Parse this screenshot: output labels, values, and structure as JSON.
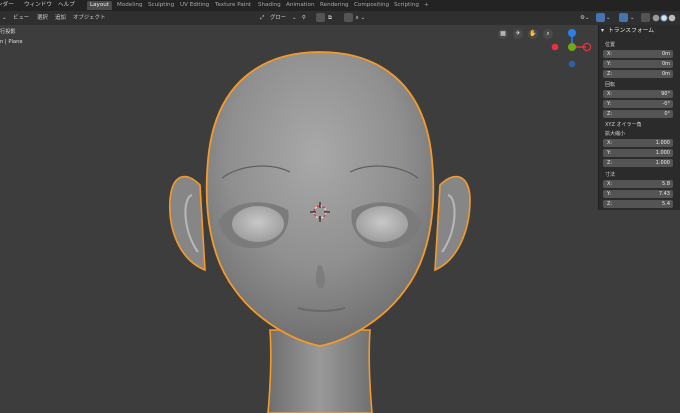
{
  "top_menu": {
    "render": "ンダー",
    "window": "ウィンドウ",
    "help": "ヘルプ"
  },
  "workspace_tabs": [
    "Layout",
    "Modeling",
    "Sculpting",
    "UV Editing",
    "Texture Paint",
    "Shading",
    "Animation",
    "Rendering",
    "Compositing",
    "Scripting"
  ],
  "add_tab": "+",
  "header": {
    "view": "ビュー",
    "select": "選択",
    "add": "追加",
    "object": "オブジェクト",
    "global": "グロー"
  },
  "viewport_info": {
    "line1": "行投影",
    "line2": "n | Plane"
  },
  "transform_panel": {
    "title": "トランスフォーム",
    "location": {
      "label": "位置",
      "x": "0m",
      "y": "0m",
      "z": "0m"
    },
    "rotation": {
      "label": "回転",
      "x": "90°",
      "y": "-0°",
      "z": "0°"
    },
    "rotation_mode": "XYZ オイラー角",
    "scale": {
      "label": "拡大縮小",
      "x": "1.000",
      "y": "1.000",
      "z": "1.000"
    },
    "dimensions": {
      "label": "寸法",
      "x": "5.8",
      "y": "7.43",
      "z": "5.4"
    },
    "axis_labels": {
      "x": "X:",
      "y": "Y:",
      "z": "Z:"
    }
  },
  "gizmo": {
    "x": "X",
    "y": "Y",
    "z": "Z"
  },
  "colors": {
    "accent_orange": "#f59a2a",
    "axis_x": "#e8333f",
    "axis_y": "#6cab17",
    "axis_z": "#2b82e6",
    "active_tab": "#4b4b4b"
  }
}
